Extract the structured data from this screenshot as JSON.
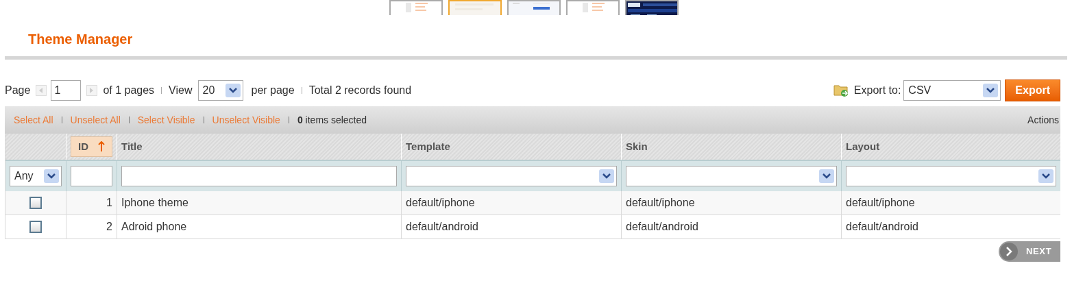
{
  "thumbnails": [
    {
      "kind": "picture",
      "selected": false
    },
    {
      "kind": "picture",
      "selected": true
    },
    {
      "kind": "picture",
      "selected": false
    },
    {
      "kind": "picture",
      "selected": false
    },
    {
      "kind": "picture",
      "selected": false
    }
  ],
  "title": "Theme Manager",
  "pager": {
    "page_label": "Page",
    "page": "1",
    "of_pages": "of 1 pages",
    "view_label": "View",
    "per_page": "20",
    "per_page_label": "per page",
    "total": "Total 2 records found"
  },
  "export": {
    "label": "Export to:",
    "format": "CSV",
    "button": "Export"
  },
  "massaction": {
    "links": [
      "Select All",
      "Unselect All",
      "Select Visible",
      "Unselect Visible"
    ],
    "count": "0",
    "count_label": "items selected",
    "actions": "Actions"
  },
  "table": {
    "columns": [
      {
        "filter": {
          "kind": "select",
          "value": "Any"
        }
      },
      {
        "label": "ID",
        "sorted": true,
        "filter": {
          "kind": "text"
        }
      },
      {
        "label": "Title",
        "sorted": false,
        "filter": {
          "kind": "text"
        }
      },
      {
        "label": "Template",
        "sorted": false,
        "filter": {
          "kind": "select"
        }
      },
      {
        "label": "Skin",
        "sorted": false,
        "filter": {
          "kind": "select"
        }
      },
      {
        "label": "Layout",
        "sorted": false,
        "filter": {
          "kind": "select"
        }
      }
    ],
    "rows": [
      {
        "checked": false,
        "id": "1",
        "title": "Iphone theme",
        "template": "default/iphone",
        "skin": "default/iphone",
        "layout": "default/iphone"
      },
      {
        "checked": false,
        "id": "2",
        "title": "Adroid phone",
        "template": "default/android",
        "skin": "default/android",
        "layout": "default/android"
      }
    ]
  },
  "next_button": "NEXT"
}
